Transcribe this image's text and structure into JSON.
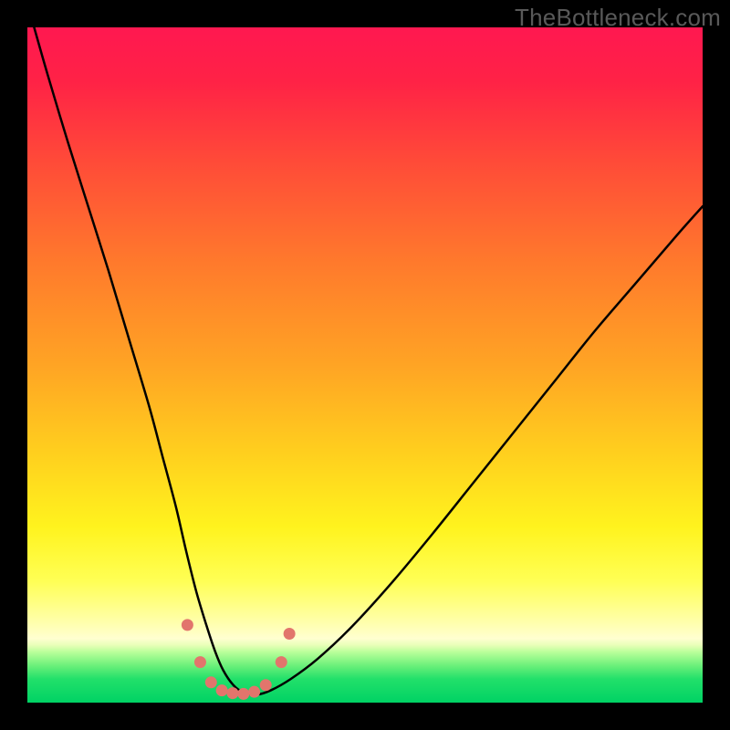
{
  "watermark": "TheBottleneck.com",
  "chart_data": {
    "type": "line",
    "title": "",
    "xlabel": "",
    "ylabel": "",
    "xlim": [
      0,
      100
    ],
    "ylim": [
      0,
      100
    ],
    "grid": false,
    "legend": false,
    "background": {
      "type": "vertical-gradient",
      "description": "Vertical red→orange→yellow→green gradient with narrow green band at bottom",
      "stops": [
        {
          "offset": 0.0,
          "color": "#ff1850"
        },
        {
          "offset": 0.08,
          "color": "#ff2246"
        },
        {
          "offset": 0.2,
          "color": "#ff4b38"
        },
        {
          "offset": 0.35,
          "color": "#ff7a2c"
        },
        {
          "offset": 0.5,
          "color": "#ffa424"
        },
        {
          "offset": 0.63,
          "color": "#ffcf1e"
        },
        {
          "offset": 0.74,
          "color": "#fff31e"
        },
        {
          "offset": 0.82,
          "color": "#ffff55"
        },
        {
          "offset": 0.88,
          "color": "#ffffaa"
        },
        {
          "offset": 0.905,
          "color": "#ffffd0"
        },
        {
          "offset": 0.915,
          "color": "#e8ffb8"
        },
        {
          "offset": 0.925,
          "color": "#baff9a"
        },
        {
          "offset": 0.945,
          "color": "#6cf07a"
        },
        {
          "offset": 0.965,
          "color": "#22e06a"
        },
        {
          "offset": 1.0,
          "color": "#00d264"
        }
      ]
    },
    "series": [
      {
        "name": "bottleneck-curve",
        "type": "line",
        "stroke": "#000000",
        "stroke_width": 2.5,
        "x": [
          1,
          3,
          6,
          9,
          12,
          15,
          18,
          20,
          22,
          23.5,
          25,
          26.5,
          27.8,
          29,
          30.5,
          32,
          34,
          36,
          39,
          43,
          48,
          54,
          60,
          66,
          72,
          78,
          84,
          90,
          96,
          100
        ],
        "y": [
          100,
          93,
          83,
          73.5,
          64,
          54,
          44,
          36.5,
          29,
          22.5,
          16.5,
          11.5,
          7.6,
          4.8,
          2.6,
          1.5,
          1.2,
          1.8,
          3.5,
          6.5,
          11.2,
          17.8,
          25,
          32.5,
          40,
          47.5,
          55,
          62,
          69,
          73.5
        ]
      }
    ],
    "markers": {
      "name": "salmon-dots",
      "color": "#e2756c",
      "radius": 6.5,
      "points": [
        {
          "x": 23.7,
          "y": 11.5
        },
        {
          "x": 25.6,
          "y": 6.0
        },
        {
          "x": 27.2,
          "y": 3.0
        },
        {
          "x": 28.8,
          "y": 1.8
        },
        {
          "x": 30.4,
          "y": 1.4
        },
        {
          "x": 32.0,
          "y": 1.3
        },
        {
          "x": 33.6,
          "y": 1.6
        },
        {
          "x": 35.3,
          "y": 2.6
        },
        {
          "x": 37.6,
          "y": 6.0
        },
        {
          "x": 38.8,
          "y": 10.2
        }
      ]
    }
  }
}
